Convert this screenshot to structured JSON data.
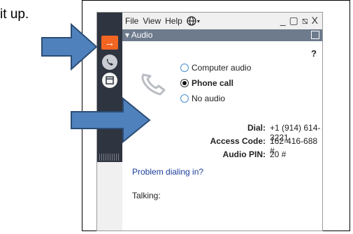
{
  "intro_text": "it up.",
  "menubar": {
    "items": [
      "File",
      "View",
      "Help"
    ],
    "globe_icon": "globe-icon"
  },
  "window_controls": {
    "minimize": "_",
    "restore": "▢",
    "pin": "⧅",
    "close": "X"
  },
  "panel": {
    "title": "Audio",
    "help": "?"
  },
  "audio_options": [
    {
      "label": "Computer audio",
      "selected": false
    },
    {
      "label": "Phone call",
      "selected": true
    },
    {
      "label": "No audio",
      "selected": false
    }
  ],
  "dial_info": [
    {
      "label": "Dial:",
      "value": "+1 (914) 614-3221"
    },
    {
      "label": "Access Code:",
      "value": "162-416-688 #"
    },
    {
      "label": "Audio PIN:",
      "value": "20 #"
    }
  ],
  "problem_link": "Problem dialing in?",
  "talking_label": "Talking:",
  "colors": {
    "arrow_fill": "#4f81bd",
    "arrow_stroke": "#2c4d75",
    "sidebar": "#2e3440",
    "active": "#f26522",
    "header": "#6d7b8d"
  }
}
